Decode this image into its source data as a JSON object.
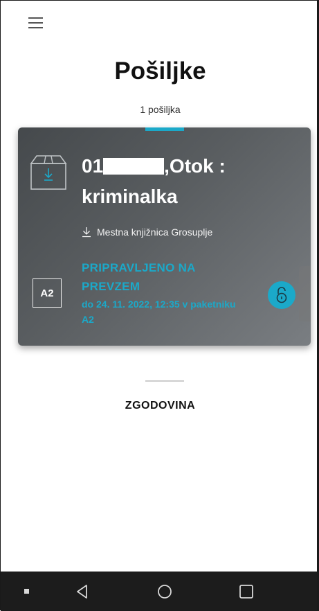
{
  "header": {
    "menu_icon": "hamburger-menu-icon",
    "title": "Pošiljke",
    "count_label": "1 pošiljka"
  },
  "shipment": {
    "title_prefix": "01",
    "title_suffix": ",Otok :",
    "title_line2": "kriminalka",
    "location": "Mestna knjižnica Grosuplje",
    "locker_badge": "A2",
    "status": "PRIPRAVLJENO NA PREVZEM",
    "status_detail": "do 24. 11. 2022, 12:35 v paketniku A2",
    "package_icon": "package-download-icon",
    "action_icon": "unlock-icon"
  },
  "history": {
    "label": "ZGODOVINA"
  },
  "navbar": {
    "items": [
      "recents-dot-icon",
      "back-icon",
      "home-icon",
      "overview-icon"
    ]
  },
  "colors": {
    "accent": "#1ba9c9",
    "card_bg": "#505457",
    "navbar_bg": "#1c1c1c"
  }
}
